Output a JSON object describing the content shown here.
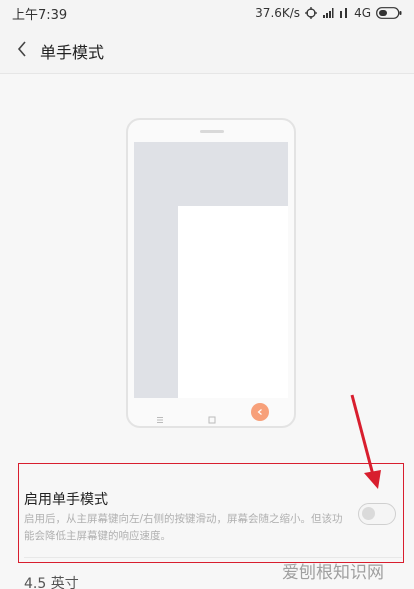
{
  "status_bar": {
    "time": "上午7:39",
    "speed": "37.6K/s",
    "network": "4G",
    "icons": [
      "sync-icon",
      "signal-icon",
      "wifi-icon",
      "battery-icon"
    ]
  },
  "header": {
    "title": "单手模式",
    "back_icon": "chevron-left-icon"
  },
  "illustration": {
    "nav_icons": [
      "menu-icon",
      "home-icon",
      "back-icon"
    ],
    "accent_color": "#f7a07a"
  },
  "setting": {
    "title": "启用单手模式",
    "description": "启用后，从主屏幕键向左/右侧的按键滑动，屏幕会随之缩小。但该功能会降低主屏幕键的响应速度。",
    "toggle_on": false
  },
  "screen_size": {
    "label": "4.5 英寸"
  },
  "annotation": {
    "highlight_color": "#d81e2e"
  },
  "watermark": {
    "text": "爱刨根知识网"
  }
}
